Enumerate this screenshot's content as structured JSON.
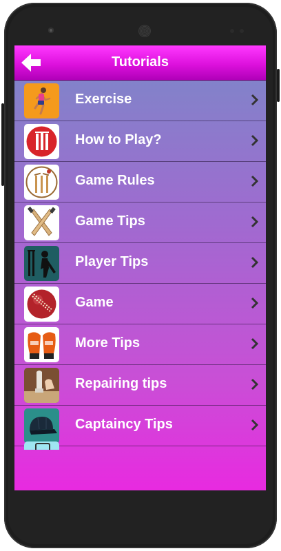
{
  "header": {
    "title": "Tutorials",
    "back_icon": "arrow-left-icon"
  },
  "colors": {
    "appbar": "#dd11dd",
    "gradient_top": "#7b88c8",
    "gradient_bottom": "#e82ae0",
    "text": "#ffffff"
  },
  "items": [
    {
      "label": "Exercise",
      "icon": "runner-icon"
    },
    {
      "label": "How to Play?",
      "icon": "cricket-ball-wicket-icon"
    },
    {
      "label": "Game Rules",
      "icon": "stumps-icon"
    },
    {
      "label": "Game Tips",
      "icon": "crossed-bats-icon"
    },
    {
      "label": "Player Tips",
      "icon": "batsman-icon"
    },
    {
      "label": "Game",
      "icon": "cricket-ball-icon"
    },
    {
      "label": "More Tips",
      "icon": "keeping-gloves-icon"
    },
    {
      "label": "Repairing tips",
      "icon": "bat-repair-icon"
    },
    {
      "label": "Captaincy Tips",
      "icon": "cricket-cap-icon"
    }
  ]
}
